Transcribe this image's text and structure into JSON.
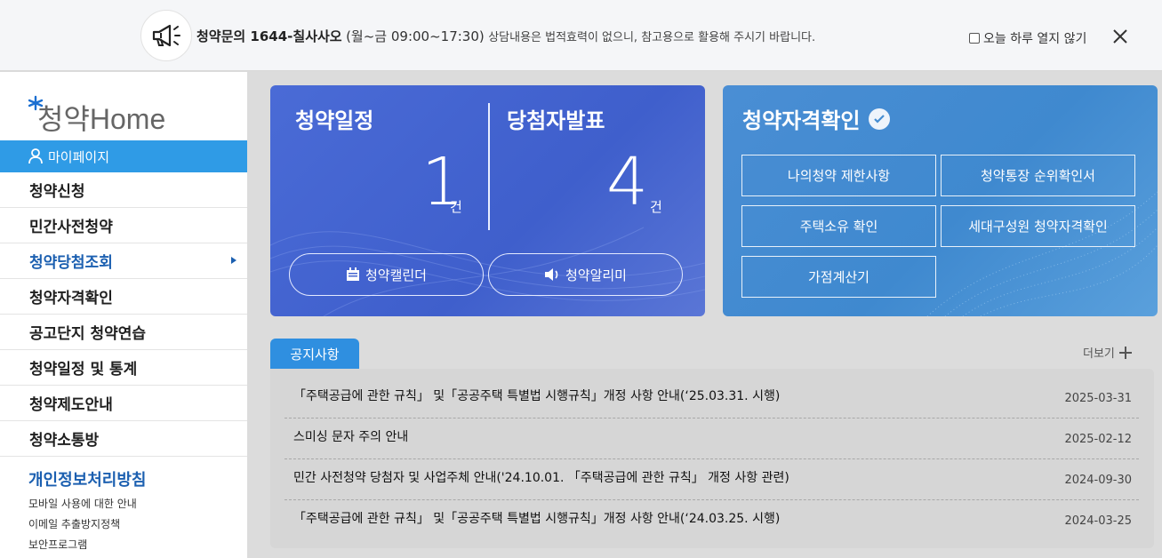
{
  "notice_bar": {
    "phone_label": "청약문의 1644-칠사사오",
    "hours": "(월~금 09:00~17:30)",
    "description": "상담내용은 법적효력이 없으니, 참고용으로 활용해 주시기 바랍니다.",
    "not_today_label": "오늘 하루 열지 않기"
  },
  "sidebar": {
    "logo_text": "청약Home",
    "mypage_label": "마이페이지",
    "menu": [
      {
        "label": "청약신청"
      },
      {
        "label": "민간사전청약"
      },
      {
        "label": "청약당첨조회"
      },
      {
        "label": "청약자격확인"
      },
      {
        "label": "공고단지 청약연습"
      },
      {
        "label": "청약일정 및 통계"
      },
      {
        "label": "청약제도안내"
      },
      {
        "label": "청약소통방"
      }
    ],
    "privacy_label": "개인정보처리방침",
    "sub_links": [
      "모바일 사용에 대한 안내",
      "이메일 추출방지정책",
      "보안프로그램"
    ]
  },
  "schedule_card": {
    "schedule_title": "청약일정",
    "schedule_count": "1",
    "schedule_unit": "건",
    "winner_title": "당첨자발표",
    "winner_count": "4",
    "winner_unit": "건",
    "calendar_button": "청약캘린더",
    "alarm_button": "청약알리미"
  },
  "qualification_card": {
    "title": "청약자격확인",
    "buttons": [
      "나의청약 제한사항",
      "청약통장 순위확인서",
      "주택소유 확인",
      "세대구성원 청약자격확인",
      "가점계산기"
    ]
  },
  "notices": {
    "tab_label": "공지사항",
    "more_label": "더보기",
    "items": [
      {
        "title": "「주택공급에 관한 규칙」 및「공공주택 특별법 시행규칙」개정 사항 안내(‘25.03.31. 시행)",
        "date": "2025-03-31"
      },
      {
        "title": "스미싱 문자 주의 안내",
        "date": "2025-02-12"
      },
      {
        "title": "민간 사전청약 당첨자 및 사업주체 안내('24.10.01. 「주택공급에 관한 규칙」 개정 사항 관련)",
        "date": "2024-09-30"
      },
      {
        "title": "「주택공급에 관한 규칙」 및「공공주택 특별법 시행규칙」개정 사항 안내(‘24.03.25. 시행)",
        "date": "2024-03-25"
      }
    ]
  },
  "colors": {
    "accent": "#2f9be6",
    "schedule_card": "#4565d1",
    "qualification_card": "#448cd1",
    "active_menu": "#1b5fb0"
  }
}
